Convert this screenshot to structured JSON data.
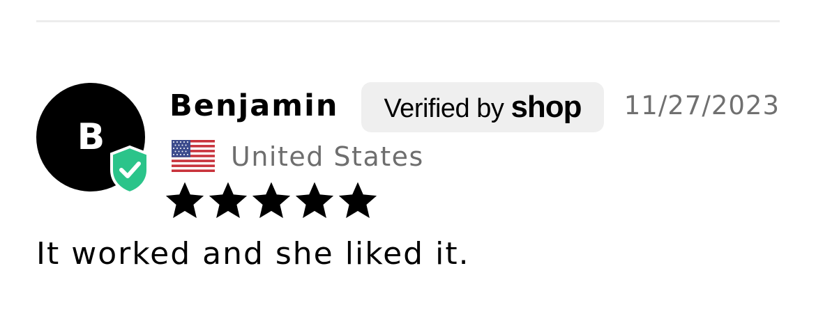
{
  "review": {
    "author": {
      "initial": "B",
      "name": "Benjamin",
      "verified_icon": "verified-shield-check-icon",
      "country": "United States",
      "flag_icon": "us-flag-icon"
    },
    "badge": {
      "prefix": "Verified by ",
      "brand": "shop"
    },
    "date": "11/27/2023",
    "rating": 5,
    "rating_max": 5,
    "text": "It worked and she liked it."
  },
  "colors": {
    "avatar_background": "#000000",
    "verified_green": "#2bc48a",
    "badge_background": "#efefef",
    "date_text": "#707070",
    "country_text": "#6e6e6e",
    "divider": "#ececec",
    "star": "#000000"
  }
}
